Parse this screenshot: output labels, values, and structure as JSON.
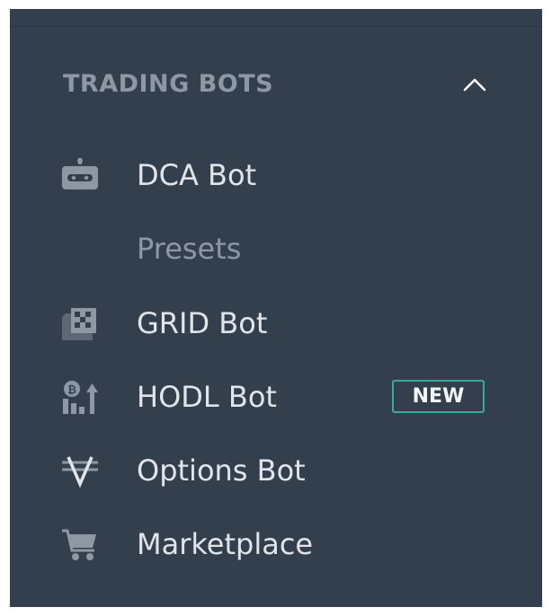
{
  "section": {
    "title": "TRADING BOTS"
  },
  "menu": {
    "items": [
      {
        "label": "DCA Bot",
        "icon": "robot-icon"
      },
      {
        "label": "Presets",
        "icon": ""
      },
      {
        "label": "GRID Bot",
        "icon": "grid-icon"
      },
      {
        "label": "HODL Bot",
        "icon": "hodl-icon",
        "badge": "NEW"
      },
      {
        "label": "Options Bot",
        "icon": "options-icon"
      },
      {
        "label": "Marketplace",
        "icon": "cart-icon"
      }
    ]
  },
  "colors": {
    "background": "#343f4d",
    "text": "#e1e5ea",
    "muted": "#8e98a4",
    "badge_border": "#3ba99a"
  }
}
